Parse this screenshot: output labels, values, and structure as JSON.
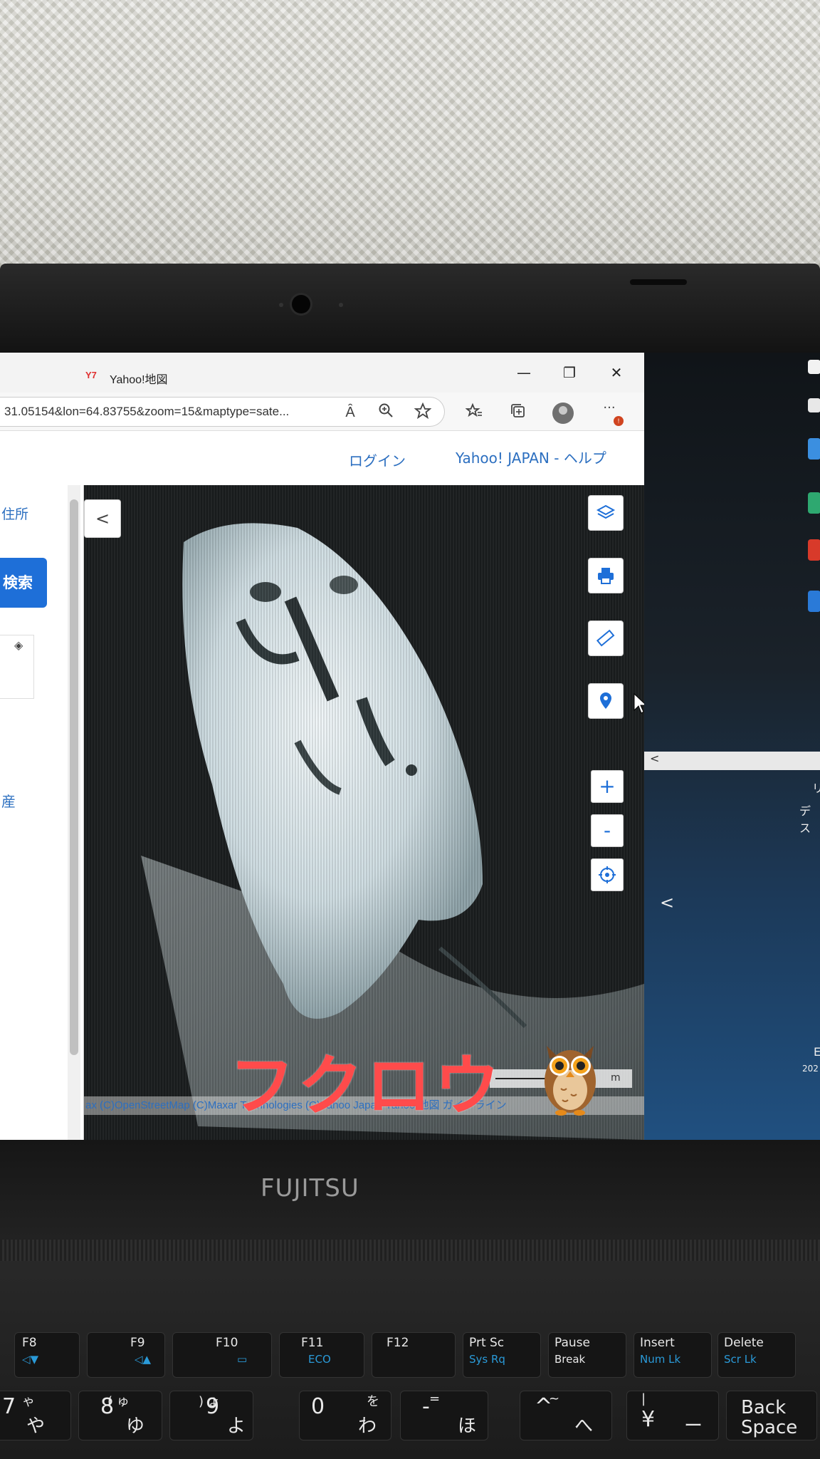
{
  "browser": {
    "tab_title": "Yahoo!地図",
    "tab_logo": "Y7",
    "url": "31.05154&lon=64.83755&zoom=15&maptype=sate...",
    "window_minimize": "—",
    "window_restore": "❐",
    "window_close": "✕",
    "read_aloud": "Ȃ",
    "badge": "!"
  },
  "yahoo_header": {
    "login": "ログイン",
    "help": "Yahoo! JAPAN - ヘルプ"
  },
  "sidepanel": {
    "address_label": "住所",
    "search_button": "検索",
    "bottom_label": "産"
  },
  "map": {
    "collapse": "<",
    "zoom_in": "+",
    "zoom_out": "-",
    "scale_label": "m",
    "attribution": "ax (C)OpenStreetMap (C)Maxar Technologies (C)Yahoo Japan Yahoo!地図 ガイドライン"
  },
  "desktop": {
    "strip_chevron": "<",
    "chevron": "<",
    "text_1": "リ",
    "text_2": "デス",
    "text_3": "E",
    "text_4": "202"
  },
  "laptop": {
    "brand": "FUJITSU"
  },
  "keyboard": {
    "fn_keys": [
      {
        "main": "F8",
        "sub": "◁▼"
      },
      {
        "main": "F9",
        "sub": "◁▲"
      },
      {
        "main": "F10",
        "sub": "▭"
      },
      {
        "main": "F11",
        "sub": "ECO"
      },
      {
        "main": "F12",
        "sub": ""
      },
      {
        "main": "Prt Sc",
        "sub": "Sys Rq"
      },
      {
        "main": "Pause",
        "sub": "Break"
      },
      {
        "main": "Insert",
        "sub": "Num Lk"
      },
      {
        "main": "Delete",
        "sub": "Scr Lk"
      }
    ],
    "num_keys": [
      {
        "main": "7",
        "kana": "や",
        "small": "ゃ"
      },
      {
        "main": "8",
        "kana": "ゆ",
        "small": "( ゅ"
      },
      {
        "main": "9",
        "kana": "よ",
        "small": ") ょ"
      },
      {
        "main": "0",
        "kana": "わ",
        "small": "を"
      },
      {
        "main": "-",
        "kana": "ほ",
        "small": "="
      },
      {
        "main": "^",
        "kana": "へ",
        "small": "~"
      },
      {
        "main": "¥",
        "kana": "ー",
        "small": "|"
      }
    ],
    "backspace_line1": "Back",
    "backspace_line2": "Space"
  },
  "overlay": {
    "caption": "フクロウ",
    "emoji_icon": "owl-emoji"
  },
  "colors": {
    "caption": "#ff4b4b",
    "link": "#2c6fc0",
    "search_button": "#1e6fd8",
    "key_sub": "#2a9ad8"
  }
}
